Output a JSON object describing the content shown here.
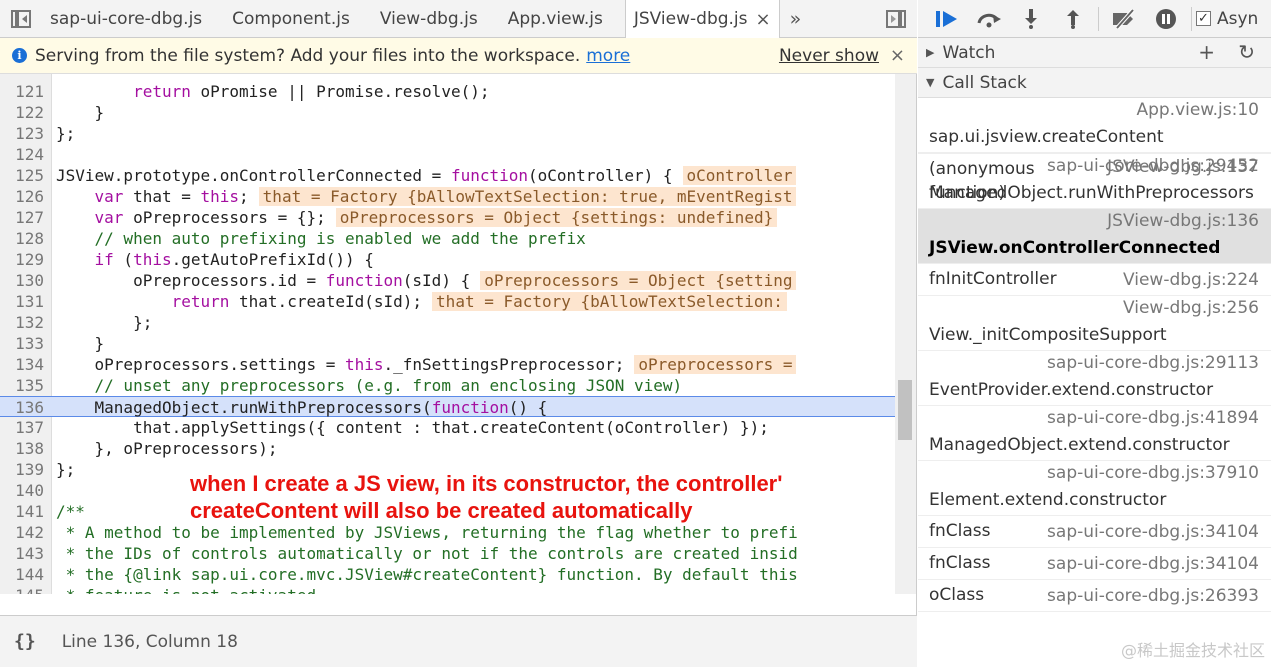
{
  "tabs": [
    {
      "label": "sap-ui-core-dbg.js"
    },
    {
      "label": "Component.js"
    },
    {
      "label": "View-dbg.js"
    },
    {
      "label": "App.view.js"
    },
    {
      "label": "JSView-dbg.js",
      "active": true
    }
  ],
  "tabs_overflow": "»",
  "infobar": {
    "message": "Serving from the file system? Add your files into the workspace.",
    "more_link": "more",
    "never_show": "Never show",
    "close": "×"
  },
  "code_lines": [
    {
      "num": "121",
      "text": "        return oPromise || Promise.resolve();"
    },
    {
      "num": "122",
      "text": "    }"
    },
    {
      "num": "123",
      "text": "};"
    },
    {
      "num": "124",
      "text": ""
    },
    {
      "num": "125",
      "text": "JSView.prototype.onControllerConnected = function(oController) {",
      "inline": "oController"
    },
    {
      "num": "126",
      "text": "    var that = this;",
      "inline": "that = Factory {bAllowTextSelection: true, mEventRegist"
    },
    {
      "num": "127",
      "text": "    var oPreprocessors = {};",
      "inline": "oPreprocessors = Object {settings: undefined}"
    },
    {
      "num": "128",
      "text": "    // when auto prefixing is enabled we add the prefix"
    },
    {
      "num": "129",
      "text": "    if (this.getAutoPrefixId()) {"
    },
    {
      "num": "130",
      "text": "        oPreprocessors.id = function(sId) {",
      "inline": "oPreprocessors = Object {setting"
    },
    {
      "num": "131",
      "text": "            return that.createId(sId);",
      "inline": "that = Factory {bAllowTextSelection:"
    },
    {
      "num": "132",
      "text": "        };"
    },
    {
      "num": "133",
      "text": "    }"
    },
    {
      "num": "134",
      "text": "    oPreprocessors.settings = this._fnSettingsPreprocessor;",
      "inline": "oPreprocessors ="
    },
    {
      "num": "135",
      "text": "    // unset any preprocessors (e.g. from an enclosing JSON view)"
    },
    {
      "num": "136",
      "text": "    ManagedObject.runWithPreprocessors(function() {"
    },
    {
      "num": "137",
      "text": "        that.applySettings({ content : that.createContent(oController) });"
    },
    {
      "num": "138",
      "text": "    }, oPreprocessors);"
    },
    {
      "num": "139",
      "text": "};"
    },
    {
      "num": "140",
      "text": ""
    },
    {
      "num": "141",
      "text": "/**"
    },
    {
      "num": "142",
      "text": " * A method to be implemented by JSViews, returning the flag whether to prefi"
    },
    {
      "num": "143",
      "text": " * the IDs of controls automatically or not if the controls are created insid"
    },
    {
      "num": "144",
      "text": " * the {@link sap.ui.core.mvc.JSView#createContent} function. By default this"
    },
    {
      "num": "145",
      "text": " * feature is not activated."
    }
  ],
  "highlighted_line": "136",
  "annotation": "when I create a JS view, in its constructor, the controller'\ncreateContent will also be created automatically",
  "statusbar": {
    "pretty_print": "{}",
    "position": "Line 136, Column 18"
  },
  "debugger": {
    "async_label": "Asyn",
    "watch_label": "Watch",
    "call_stack_label": "Call Stack",
    "frames": [
      {
        "fn": "sap.ui.jsview.createContent",
        "loc": "App.view.js:10",
        "layout": "two"
      },
      {
        "fn": "(anonymous function)",
        "loc": "JSView-dbg.js:137",
        "layout": "multi"
      },
      {
        "fn": "ManagedObject.runWithPreprocessors",
        "loc": "sap-ui-core-dbg.js:29452",
        "layout": "two"
      },
      {
        "fn": "JSView.onControllerConnected",
        "loc": "JSView-dbg.js:136",
        "layout": "two",
        "selected": true
      },
      {
        "fn": "fnInitController",
        "loc": "View-dbg.js:224",
        "layout": "one"
      },
      {
        "fn": "View._initCompositeSupport",
        "loc": "View-dbg.js:256",
        "layout": "two"
      },
      {
        "fn": "EventProvider.extend.constructor",
        "loc": "sap-ui-core-dbg.js:29113",
        "layout": "two"
      },
      {
        "fn": "ManagedObject.extend.constructor",
        "loc": "sap-ui-core-dbg.js:41894",
        "layout": "two"
      },
      {
        "fn": "Element.extend.constructor",
        "loc": "sap-ui-core-dbg.js:37910",
        "layout": "two"
      },
      {
        "fn": "fnClass",
        "loc": "sap-ui-core-dbg.js:34104",
        "layout": "one"
      },
      {
        "fn": "fnClass",
        "loc": "sap-ui-core-dbg.js:34104",
        "layout": "one"
      },
      {
        "fn": "oClass",
        "loc": "sap-ui-core-dbg.js:26393",
        "layout": "one"
      }
    ]
  },
  "watermark": "@稀土掘金技术社区"
}
